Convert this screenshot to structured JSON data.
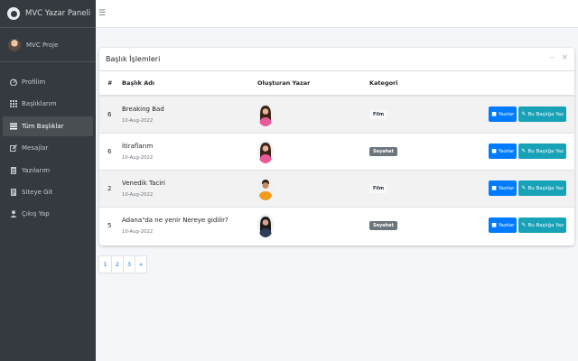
{
  "brand": {
    "title": "MVC Yazar Paneli"
  },
  "user": {
    "name": "MVC Proje"
  },
  "sidebar": {
    "items": [
      {
        "label": "Profilim",
        "icon": "dashboard-icon",
        "active": false
      },
      {
        "label": "Başlıklarım",
        "icon": "grid-icon",
        "active": false
      },
      {
        "label": "Tüm Başlıklar",
        "icon": "list-icon",
        "active": true
      },
      {
        "label": "Mesajlar",
        "icon": "edit-icon",
        "active": false
      },
      {
        "label": "Yazılarım",
        "icon": "document-icon",
        "active": false
      },
      {
        "label": "Siteye Git",
        "icon": "page-icon",
        "active": false
      },
      {
        "label": "Çıkış Yap",
        "icon": "user-icon",
        "active": false
      }
    ]
  },
  "card": {
    "title": "Başlık İşlemleri",
    "headers": {
      "num": "#",
      "title": "Başlık Adı",
      "author": "Oluşturan Yazar",
      "category": "Kategori"
    }
  },
  "rows": [
    {
      "num": "6",
      "title": "Breaking Bad",
      "date": "10-Aug-2022",
      "category": "Film",
      "category_style": "light",
      "avatar": "woman-pink"
    },
    {
      "num": "6",
      "title": "İtiraflarım",
      "date": "10-Aug-2022",
      "category": "Seyahat",
      "category_style": "dark",
      "avatar": "woman-pink"
    },
    {
      "num": "2",
      "title": "Venedik Taciri",
      "date": "10-Aug-2022",
      "category": "Film",
      "category_style": "light",
      "avatar": "man-orange"
    },
    {
      "num": "5",
      "title": "Adana\"da ne yenir Nereye gidilir?",
      "date": "10-Aug-2022",
      "category": "Seyahat",
      "category_style": "dark",
      "avatar": "woman-dark"
    }
  ],
  "buttons": {
    "posts": "Yazılar",
    "write": "Bu Başlığa Yaz"
  },
  "pagination": [
    "1",
    "2",
    "3",
    "»"
  ],
  "colors": {
    "primary": "#007bff",
    "info": "#17a2b8",
    "sidebar": "#343a40"
  }
}
